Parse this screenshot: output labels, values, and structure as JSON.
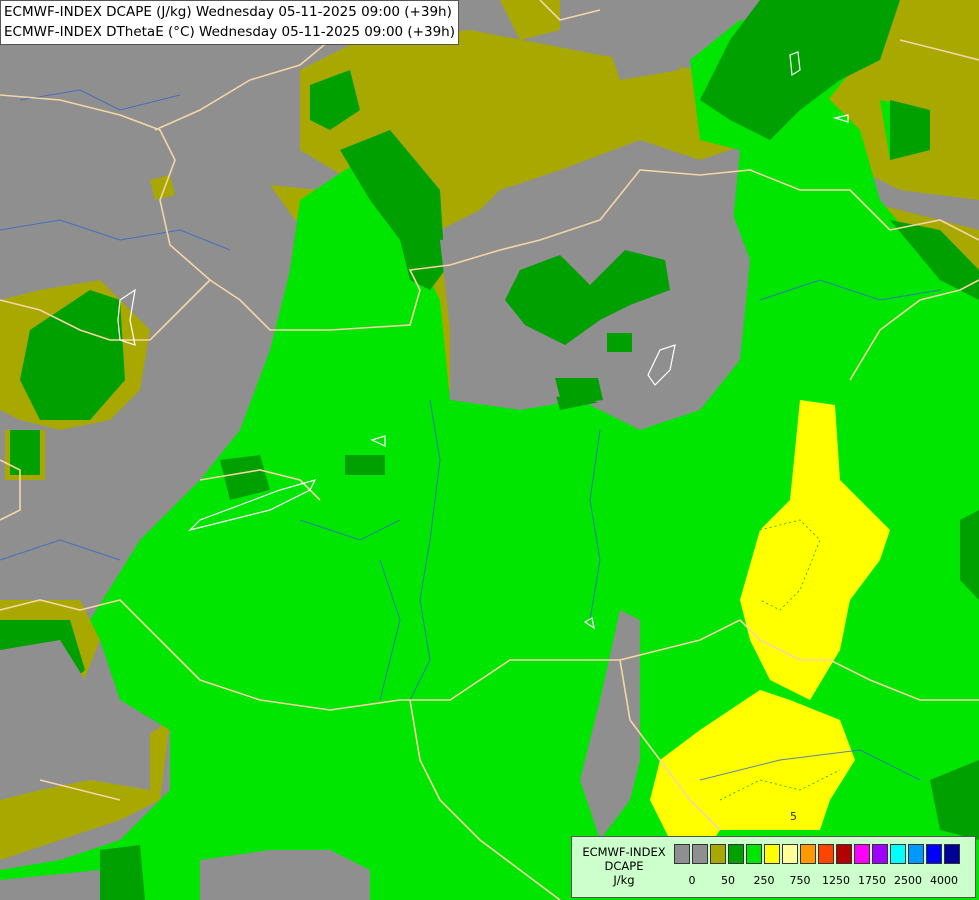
{
  "title": {
    "line1": "ECMWF-INDEX DCAPE (J/kg) Wednesday 05-11-2025 09:00 (+39h)",
    "line2": "ECMWF-INDEX DThetaE (°C) Wednesday 05-11-2025 09:00 (+39h)"
  },
  "legend": {
    "line1": "ECMWF-INDEX",
    "line2": "DCAPE",
    "line3": "J/kg",
    "ticks": [
      "0",
      "50",
      "250",
      "750",
      "1250",
      "1750",
      "2500",
      "4000"
    ],
    "colors": [
      "#8f8f8f",
      "#8f8f8f",
      "#a8a800",
      "#00a000",
      "#00e600",
      "#ffff00",
      "#ffff99",
      "#ff9900",
      "#ff4400",
      "#b30000",
      "#ff00ff",
      "#a000ff",
      "#00ffff",
      "#0099ff",
      "#0000ff",
      "#000099"
    ]
  },
  "map_colors": {
    "no_data": "#8f8f8f",
    "olive": "#a8a800",
    "dark_green": "#00a000",
    "green": "#00e600",
    "yellow": "#ffff00",
    "borders": "#f5d5a6",
    "rivers": "#3366cc"
  },
  "contour_label": "5"
}
